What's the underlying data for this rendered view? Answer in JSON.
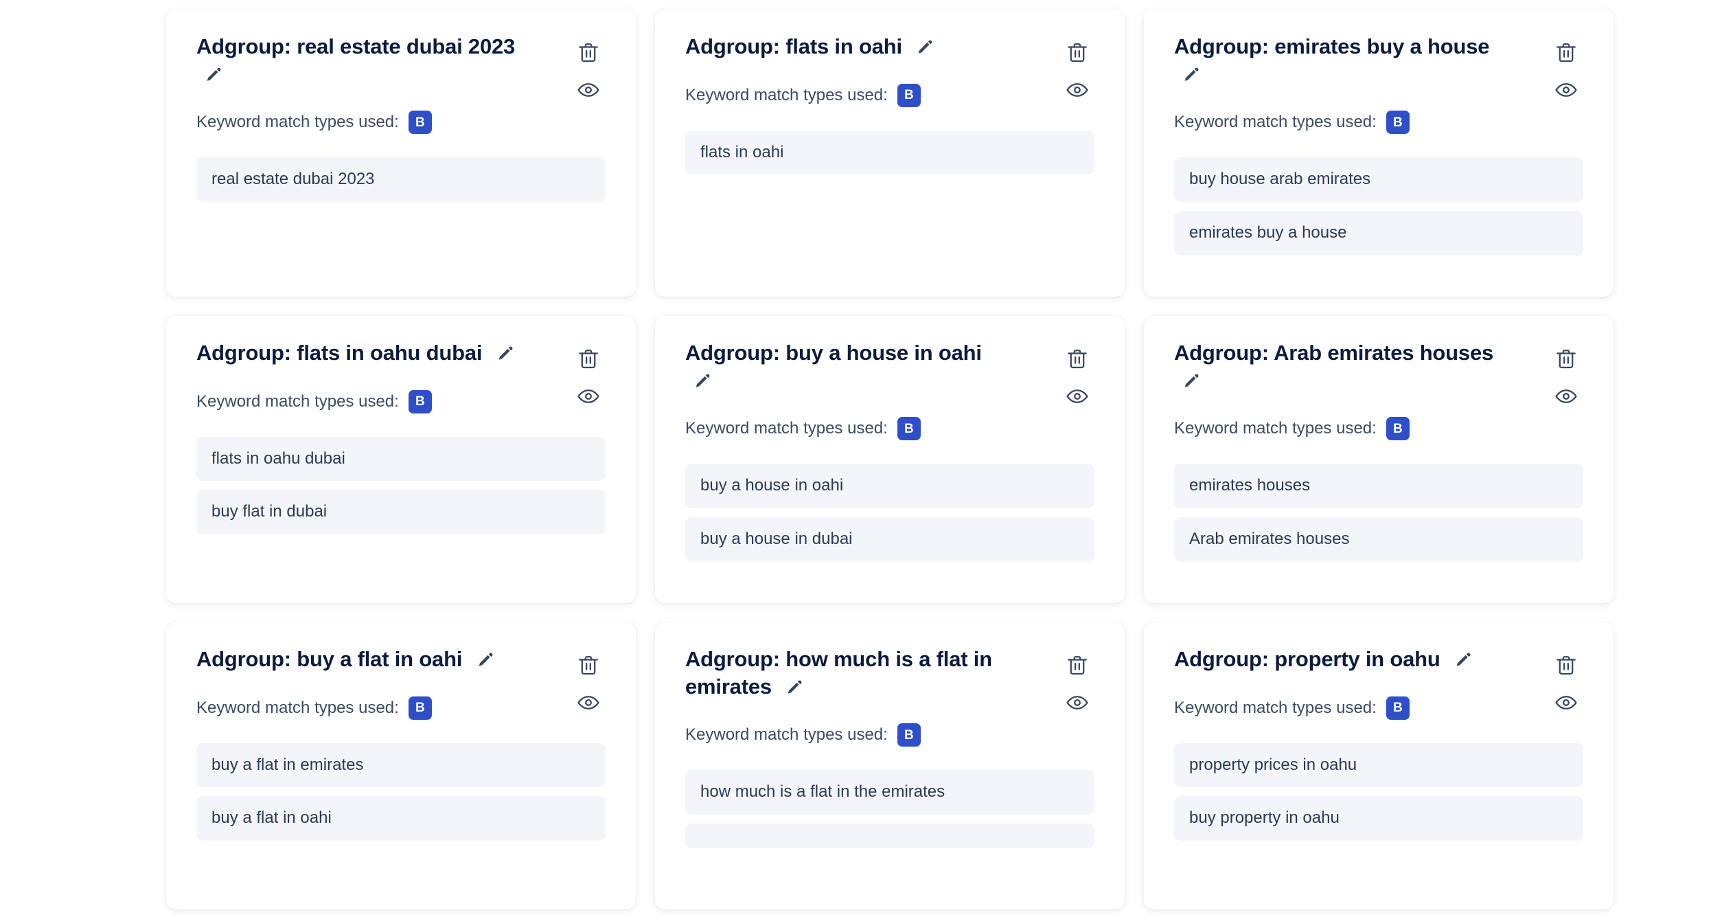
{
  "colors": {
    "page_background": "#ffffff",
    "card_background": "#ffffff",
    "title_text": "#0d1b3e",
    "label_text": "#3c4a63",
    "badge_background": "#2f4fc9",
    "badge_text": "#ffffff",
    "keyword_pill_background": "#f4f5f8",
    "keyword_pill_text": "#2b3a55",
    "icon_stroke": "#39465e"
  },
  "icons": {
    "edit": "pencil-icon",
    "delete": "trash-icon",
    "preview": "eye-icon"
  },
  "labels": {
    "match_types": "Keyword match types used:",
    "badge_broad": "B"
  },
  "cards": [
    {
      "title": "Adgroup: real estate dubai 2023",
      "match_types": [
        "B"
      ],
      "keywords": [
        "real estate dubai 2023"
      ]
    },
    {
      "title": "Adgroup: flats in oahi",
      "match_types": [
        "B"
      ],
      "keywords": [
        "flats in oahi"
      ]
    },
    {
      "title": "Adgroup: emirates buy a house",
      "match_types": [
        "B"
      ],
      "keywords": [
        "buy house arab emirates",
        "emirates buy a house"
      ]
    },
    {
      "title": "Adgroup: flats in oahu dubai",
      "match_types": [
        "B"
      ],
      "keywords": [
        "flats in oahu dubai",
        "buy flat in dubai"
      ]
    },
    {
      "title": "Adgroup: buy a house in oahi",
      "match_types": [
        "B"
      ],
      "keywords": [
        "buy a house in oahi",
        "buy a house in dubai"
      ]
    },
    {
      "title": "Adgroup: Arab emirates houses",
      "match_types": [
        "B"
      ],
      "keywords": [
        "emirates houses",
        "Arab emirates houses"
      ]
    },
    {
      "title": "Adgroup: buy a flat in oahi",
      "match_types": [
        "B"
      ],
      "keywords": [
        "buy a flat in emirates",
        "buy a flat in oahi"
      ]
    },
    {
      "title": "Adgroup: how much is a flat in emirates",
      "match_types": [
        "B"
      ],
      "keywords": [
        "how much is a flat in the emirates",
        ""
      ]
    },
    {
      "title": "Adgroup: property in oahu",
      "match_types": [
        "B"
      ],
      "keywords": [
        "property prices in oahu",
        "buy property in oahu"
      ]
    }
  ]
}
